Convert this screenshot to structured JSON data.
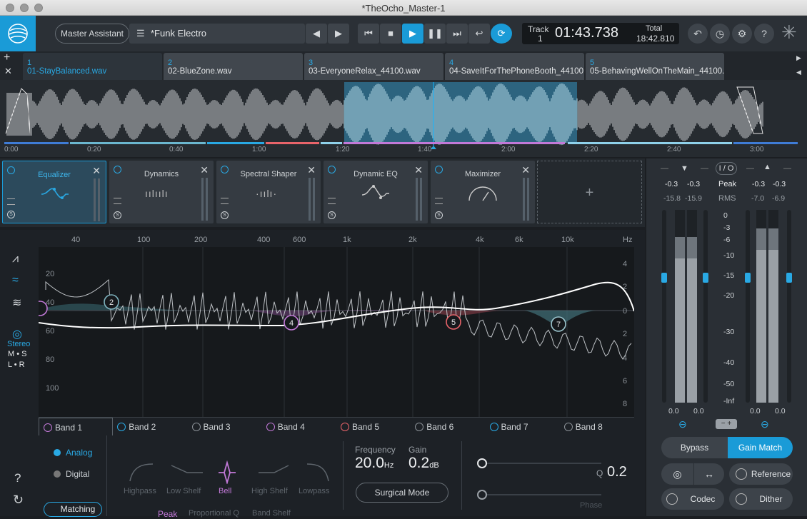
{
  "window": {
    "title": "*TheOcho_Master-1"
  },
  "toolbar": {
    "master_assistant": "Master Assistant",
    "preset": "*Funk Electro",
    "track_label": "Track",
    "track_number": "1",
    "time": "01:43.738",
    "total_label": "Total",
    "total_time": "18:42.810"
  },
  "tabs": [
    {
      "num": "1",
      "file": "01-StayBalanced.wav"
    },
    {
      "num": "2",
      "file": "02-BlueZone.wav"
    },
    {
      "num": "3",
      "file": "03-EveryoneRelax_44100.wav"
    },
    {
      "num": "4",
      "file": "04-SaveItForThePhoneBooth_44100..."
    },
    {
      "num": "5",
      "file": "05-BehavingWellOnTheMain_44100...."
    }
  ],
  "timeline": [
    "0:00",
    "0:20",
    "0:40",
    "1:00",
    "1:20",
    "1:40",
    "2:00",
    "2:20",
    "2:40",
    "3:00"
  ],
  "modules": [
    {
      "name": "Equalizer"
    },
    {
      "name": "Dynamics"
    },
    {
      "name": "Spectral Shaper"
    },
    {
      "name": "Dynamic EQ"
    },
    {
      "name": "Maximizer"
    }
  ],
  "add_module": "+",
  "eq": {
    "freq_labels": [
      "40",
      "100",
      "200",
      "400",
      "600",
      "1k",
      "2k",
      "4k",
      "6k",
      "10k",
      "Hz"
    ],
    "db_left": [
      "20",
      "40",
      "60",
      "80",
      "100"
    ],
    "db_right": [
      "4",
      "2",
      "0",
      "2",
      "4",
      "6",
      "8"
    ],
    "nodes": [
      "2",
      "4",
      "5",
      "7"
    ],
    "stereo": "Stereo",
    "ms": "M • S",
    "lr": "L • R"
  },
  "bands": [
    "Band 1",
    "Band 2",
    "Band 3",
    "Band 4",
    "Band 5",
    "Band 6",
    "Band 7",
    "Band 8"
  ],
  "band_controls": {
    "analog": "Analog",
    "digital": "Digital",
    "matching": "Matching",
    "shapes": [
      "Highpass",
      "Low Shelf",
      "Bell",
      "High Shelf",
      "Lowpass"
    ],
    "modes": [
      "Peak",
      "Proportional Q",
      "Band Shelf"
    ],
    "frequency_label": "Frequency",
    "frequency_value": "20.0",
    "frequency_unit": "Hz",
    "gain_label": "Gain",
    "gain_value": "0.2",
    "gain_unit": "dB",
    "surgical_mode": "Surgical Mode",
    "q_label": "Q",
    "q_value": "0.2",
    "phase_label": "Phase"
  },
  "meters": {
    "io": "I / O",
    "in_peak": [
      "-0.3",
      "-0.3"
    ],
    "out_peak": [
      "-0.3",
      "-0.3"
    ],
    "peak_label": "Peak",
    "in_rms": [
      "-15.8",
      "-15.9"
    ],
    "out_rms": [
      "-7.0",
      "-6.9"
    ],
    "rms_label": "RMS",
    "scale": [
      "0",
      "-3",
      "-6",
      "-10",
      "-15",
      "-20",
      "-30",
      "-40",
      "-50",
      "-Inf"
    ],
    "in_bottom": [
      "0.0",
      "0.0"
    ],
    "out_bottom": [
      "0.0",
      "0.0"
    ]
  },
  "footer": {
    "bypass": "Bypass",
    "gain_match": "Gain Match",
    "reference": "Reference",
    "codec": "Codec",
    "dither": "Dither"
  },
  "colors": {
    "accent": "#1a9bd7",
    "band_purple": "#c279d8",
    "band_red": "#e8646a"
  }
}
